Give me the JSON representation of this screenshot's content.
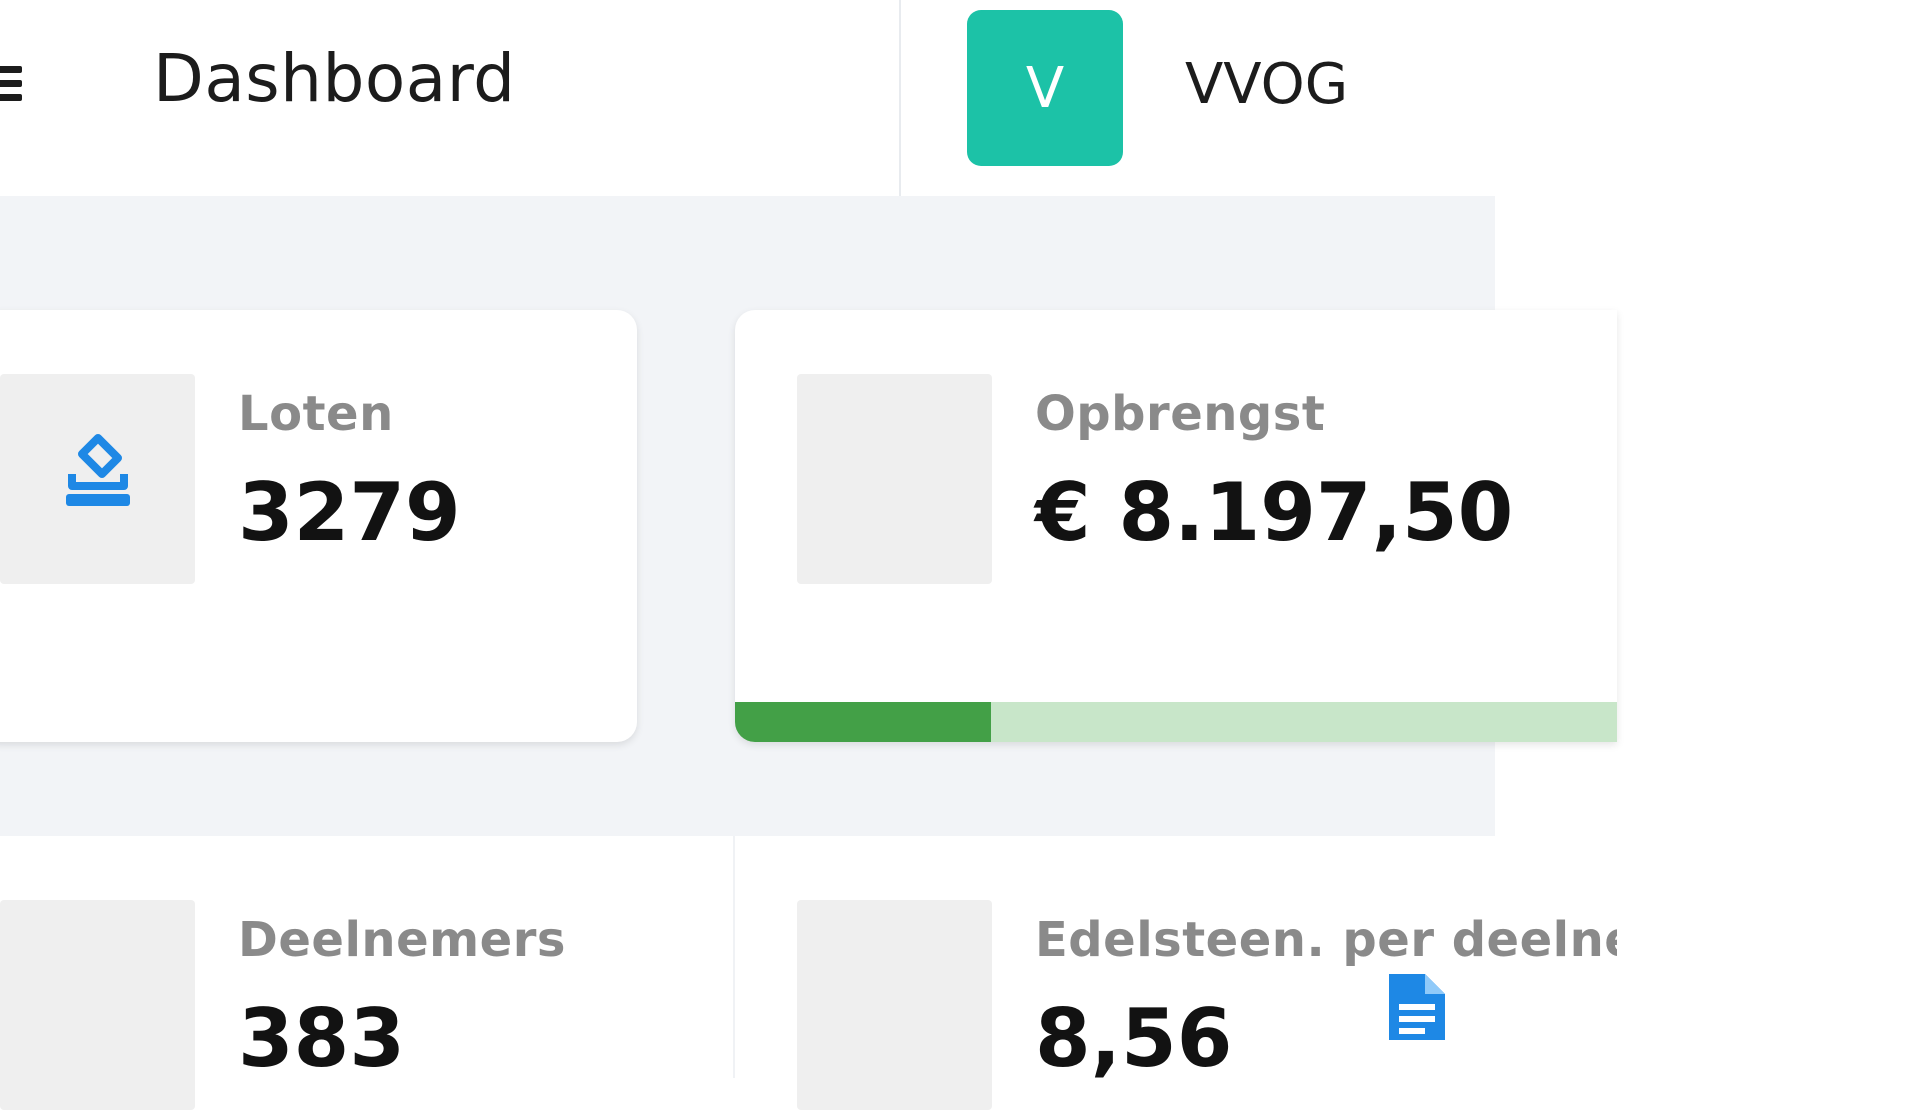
{
  "header": {
    "title": "Dashboard",
    "avatar_letter": "V",
    "org_name": "VVOG"
  },
  "stats": {
    "loten": {
      "label": "Loten",
      "value": "3279",
      "icon": "ballot-box-icon"
    },
    "opbrengst": {
      "label": "Opbrengst",
      "value": "€ 8.197,50",
      "progress_fraction": 0.29
    },
    "deelnemers": {
      "label": "Deelnemers",
      "value": "383"
    },
    "edelsteen": {
      "label": "Edelsteen. per deelne",
      "value": "8,56",
      "icon": "document-icon"
    }
  },
  "colors": {
    "accent": "#1cc2a7",
    "icon_blue": "#1e88e5",
    "progress_fill": "#43a047",
    "progress_track": "#c8e6c9"
  }
}
